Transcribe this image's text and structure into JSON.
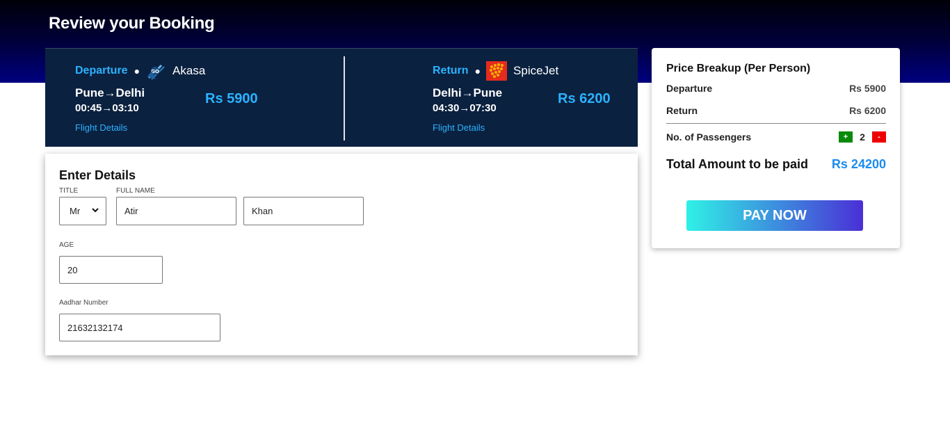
{
  "page": {
    "title": "Review your Booking"
  },
  "departure": {
    "type_label": "Departure",
    "airline": "Akasa",
    "route": "Pune→Delhi",
    "times": "00:45→03:10",
    "price": "Rs 5900",
    "details_link": "Flight Details",
    "logo_icon": "goair-logo"
  },
  "return": {
    "type_label": "Return",
    "airline": "SpiceJet",
    "route": "Delhi→Pune",
    "times": "04:30→07:30",
    "price": "Rs 6200",
    "details_link": "Flight Details",
    "logo_icon": "spicejet-logo"
  },
  "form": {
    "title": "Enter Details",
    "title_label": "TITLE",
    "fullname_label": "FULL NAME",
    "title_value": "Mr",
    "first_name": "Atir",
    "last_name": "Khan",
    "age_label": "AGE",
    "age_value": "20",
    "aadhar_label": "Aadhar Number",
    "aadhar_value": "21632132174"
  },
  "price_breakup": {
    "title": "Price Breakup (Per Person)",
    "departure_label": "Departure",
    "departure_amount": "Rs 5900",
    "return_label": "Return",
    "return_amount": "Rs 6200",
    "passengers_label": "No. of Passengers",
    "plus_label": "+",
    "passenger_count": "2",
    "minus_label": "-",
    "total_label": "Total Amount to be paid",
    "total_amount": "Rs 24200",
    "pay_button": "PAY NOW"
  },
  "colors": {
    "accent_blue": "#2bb3ff",
    "card_navy": "#0b2140",
    "plus_green": "#0a8a0a",
    "minus_red": "#ee0000",
    "pay_gradient_start": "#2ff1e6",
    "pay_gradient_end": "#4a2fd6"
  }
}
